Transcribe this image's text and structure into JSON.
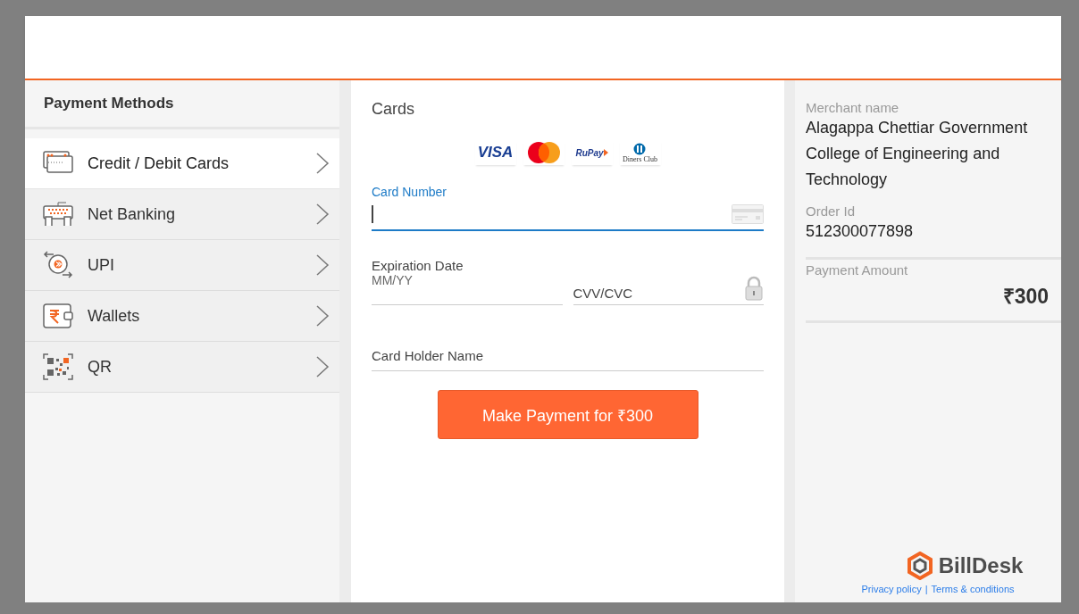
{
  "sidebar": {
    "title": "Payment Methods",
    "items": [
      {
        "kind": "card",
        "label": "Credit / Debit Cards",
        "selected": true
      },
      {
        "kind": "netbanking",
        "label": "Net Banking",
        "selected": false
      },
      {
        "kind": "upi",
        "label": "UPI",
        "selected": false
      },
      {
        "kind": "wallet",
        "label": "Wallets",
        "selected": false
      },
      {
        "kind": "qr",
        "label": "QR",
        "selected": false
      }
    ]
  },
  "cards": {
    "title": "Cards",
    "brands": [
      {
        "kind": "visa",
        "label": "VISA"
      },
      {
        "kind": "mastercard"
      },
      {
        "kind": "rupay",
        "label": "RuPay"
      },
      {
        "kind": "diners",
        "label": "Diners Club"
      }
    ],
    "card_number": {
      "label": "Card Number",
      "focused": true
    },
    "expiry": {
      "label": "Expiration Date",
      "placeholder": "MM/YY"
    },
    "cvv": {
      "placeholder": "CVV/CVC"
    },
    "holder": {
      "placeholder": "Card Holder Name"
    },
    "pay_button": "Make Payment for ₹300"
  },
  "summary": {
    "merchant_label": "Merchant name",
    "merchant": "Alagappa Chettiar Government College of Engineering and Technology",
    "order_label": "Order Id",
    "order_id": "512300077898",
    "amount_label": "Payment Amount",
    "amount": "₹300"
  },
  "footer": {
    "brand": "BillDesk",
    "links": [
      "Privacy policy",
      "Terms & conditions"
    ],
    "separator": "|"
  }
}
